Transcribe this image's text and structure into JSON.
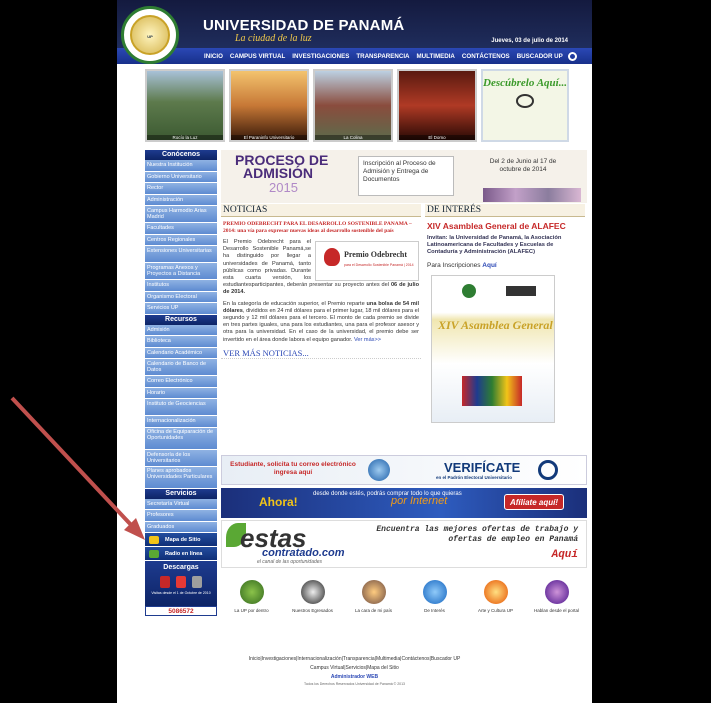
{
  "header": {
    "seal_text": "UNIVERSIDAD DE PANAMA",
    "title": "UNIVERSIDAD DE PANAMÁ",
    "motto": "La ciudad de la luz",
    "date": "Jueves, 03 de julio de 2014"
  },
  "nav": [
    "INICIO",
    "CAMPUS VIRTUAL",
    "INVESTIGACIONES",
    "TRANSPARENCIA",
    "MULTIMEDIA",
    "CONTÁCTENOS",
    "BUSCADOR UP"
  ],
  "photos": [
    "Rocío la Luz",
    "El Paraninfo Universitario",
    "La Colina",
    "El Domo"
  ],
  "descubrelo": "Descúbrelo Aquí...",
  "sidebar": {
    "conocenos": {
      "title": "Conócenos",
      "items": [
        "Nuestra Institución",
        "Gobierno Universitario",
        "Rector",
        "Administración",
        "Campus Harmodio Arias Madrid",
        "Facultades",
        "Centros Regionales",
        "Extensiones Universitarias",
        "Programas Anexos y Proyectos a Distancia",
        "Institutos",
        "Organismo Electoral",
        "Servicios UP"
      ]
    },
    "recursos": {
      "title": "Recursos",
      "items": [
        "Admisión",
        "Biblioteca",
        "Calendario Académico",
        "Calendario de Banco de Datos",
        "Correo Electrónico",
        "Horario",
        "Instituto de Geociencias",
        "Internacionalización",
        "Oficina de Equiparación de Oportunidades",
        "Defensoría de los Universitarios",
        "Planes aprobados Universidades Particulares"
      ]
    },
    "servicios": {
      "title": "Servicios",
      "items": [
        "Secretaría Virtual",
        "Profesores",
        "Graduados"
      ]
    },
    "mapa": "Mapa de Sitio",
    "radio": "Radio en línea",
    "descargas": "Descargas",
    "visits_label": "Visitas desde el 1 de Octubre de 2010",
    "counter": "5086572"
  },
  "admision": {
    "title1": "PROCESO DE",
    "title2": "ADMISIÓN",
    "year": "2015",
    "middle": "Inscripción al Proceso de Admisión y Entrega de Documentos",
    "right": "Del 2 de Junio al 17 de octubre de 2014"
  },
  "news": {
    "heading": "NOTICIAS",
    "title": "PREMIO ODEBRECHT PARA EL DESARROLLO SOSTENIBLE PANAMA – 2014: una vía para expresar nuevas ideas al desarrollo sostenible del país",
    "logo_name": "Premio Odebrecht",
    "logo_sub": "para el Desarrollo Sostenible Panamá | 2014",
    "p1_a": "El Premio Odebrecht para el Desarrollo Sostenible Panamá,se ha distinguido por llegar a universidades de Panamá, tanto públicas como privadas. Durante esta cuarta versión, los estudiantesparticipantes, deberán presentar su proyecto antes del ",
    "p1_b": "06 de julio de 2014.",
    "p2_a": "En la categoría de educación superior, el Premio reparte ",
    "p2_b": "una bolsa de 54 mil dólares",
    "p2_c": ", divididos en 24 mil dólares para el primer lugar, 18 mil dólares para el segundo y 12 mil dólares para el tercero. El monto de cada premio se divide en tres partes iguales, una para los estudiantes, una para el profesor asesor y otra para la universidad. En el caso de la universidad, el premio debe ser invertido en el área donde labora el equipo ganador.",
    "more_inline": "Ver más>>",
    "more": "VER MÁS NOTICIAS..."
  },
  "interest": {
    "heading": "DE INTERÉS",
    "title": "XIV Asamblea General de ALAFEC",
    "text": "Invitan: la Universidad de Panamá, la Asociación Latinoamericana de Facultades y Escuelas de Contaduría y Administración (ALAFEC)",
    "ins_a": "Para Inscripciones ",
    "ins_b": "Aquí",
    "poster_title": "XIV Asamblea General"
  },
  "banners": {
    "correo": "Estudiante, solicita tu correo electrónico ingresa aquí",
    "verificate": "VERIFÍCATE",
    "verificate_sub": "en el Padrón Electoral Universitario",
    "ahora": "Ahora!",
    "desde": "desde donde estés, podrás comprar todo lo que quieras",
    "internet": "por Internet",
    "afiliate": "Afíliate aquí!",
    "estas": "estas",
    "contratado": "contratado.com",
    "canal": "el canal de las oportunidades",
    "ofertas": "Encuentra las mejores ofertas de trabajo y ofertas de empleo en Panamá",
    "aqui": "Aquí"
  },
  "icons": [
    "La UP por dentro",
    "Nuestros Egresados",
    "La cara de mi país",
    "De Interés",
    "Arte y Cultura UP",
    "Hablan desde el portal"
  ],
  "footer": {
    "line1": "Inicio|Investigaciones|Internacionalización|Transparencia|Multimedia|Contáctenos|Buscador UP",
    "line2": "Campus Virtual|Servicios|Mapa del Sitio",
    "admin": "Administrador WEB",
    "copy": "Todos los Derechos Reservados Universidad de Panamá © 2013"
  },
  "colors": {
    "nav": "#1f3a9c",
    "accent_red": "#c62828",
    "sidebar": "#5e8bd1",
    "annotation_arrow": "#c0504d"
  }
}
